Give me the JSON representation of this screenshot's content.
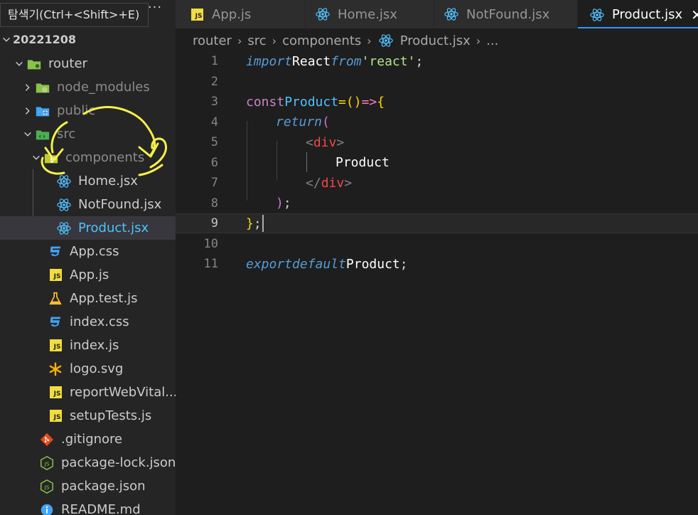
{
  "tooltip": {
    "text": "탐색기(Ctrl+<Shift>+E)"
  },
  "sidebar": {
    "root": "20221208",
    "items": [
      {
        "label": "router",
        "type": "folder",
        "icon": "router-folder-icon"
      },
      {
        "label": "node_modules",
        "type": "folder",
        "icon": "node-folder-icon"
      },
      {
        "label": "public",
        "type": "folder",
        "icon": "public-folder-icon"
      },
      {
        "label": "src",
        "type": "folder",
        "icon": "src-folder-icon"
      },
      {
        "label": "components",
        "type": "folder",
        "icon": "components-folder-icon"
      },
      {
        "label": "Home.jsx",
        "type": "file",
        "icon": "react-icon"
      },
      {
        "label": "NotFound.jsx",
        "type": "file",
        "icon": "react-icon"
      },
      {
        "label": "Product.jsx",
        "type": "file",
        "icon": "react-icon"
      },
      {
        "label": "App.css",
        "type": "file",
        "icon": "css-icon"
      },
      {
        "label": "App.js",
        "type": "file",
        "icon": "js-icon"
      },
      {
        "label": "App.test.js",
        "type": "file",
        "icon": "test-flask-icon"
      },
      {
        "label": "index.css",
        "type": "file",
        "icon": "css-icon"
      },
      {
        "label": "index.js",
        "type": "file",
        "icon": "js-icon"
      },
      {
        "label": "logo.svg",
        "type": "file",
        "icon": "svg-asterisk-icon"
      },
      {
        "label": "reportWebVital...",
        "type": "file",
        "icon": "js-icon"
      },
      {
        "label": "setupTests.js",
        "type": "file",
        "icon": "js-icon"
      },
      {
        "label": ".gitignore",
        "type": "file",
        "icon": "git-icon"
      },
      {
        "label": "package-lock.json",
        "type": "file",
        "icon": "nodejs-icon"
      },
      {
        "label": "package.json",
        "type": "file",
        "icon": "nodejs-icon"
      },
      {
        "label": "README.md",
        "type": "file",
        "icon": "info-icon"
      }
    ],
    "js_badge": "JS"
  },
  "tabs": [
    {
      "label": "App.js"
    },
    {
      "label": "Home.jsx"
    },
    {
      "label": "NotFound.jsx"
    },
    {
      "label": "Product.jsx",
      "close": "✕"
    }
  ],
  "breadcrumb": {
    "parts": [
      "router",
      "src",
      "components",
      "Product.jsx",
      "..."
    ],
    "sep": "›"
  },
  "editor": {
    "line_numbers": [
      "1",
      "2",
      "3",
      "4",
      "5",
      "6",
      "7",
      "8",
      "9",
      "10",
      "11"
    ],
    "tokens": {
      "import": "import",
      "React": "React",
      "from": "from",
      "react_str": "'react'",
      "semi": ";",
      "const": "const",
      "Product": "Product",
      "eq": "=",
      "parens": "()",
      "arrow": "=>",
      "lbrace": "{",
      "return": "return",
      "lparen": "(",
      "lt": "<",
      "div": "div",
      "gt": ">",
      "lt_slash": "</",
      "text": "Product",
      "rparen": ")",
      "rbrace": "}",
      "export": "export",
      "default": "default"
    }
  },
  "colors": {
    "accent": "#3794ff",
    "react": "#4fc1ff",
    "js": "#f1dd3f",
    "annotation": "#f5f04a"
  }
}
